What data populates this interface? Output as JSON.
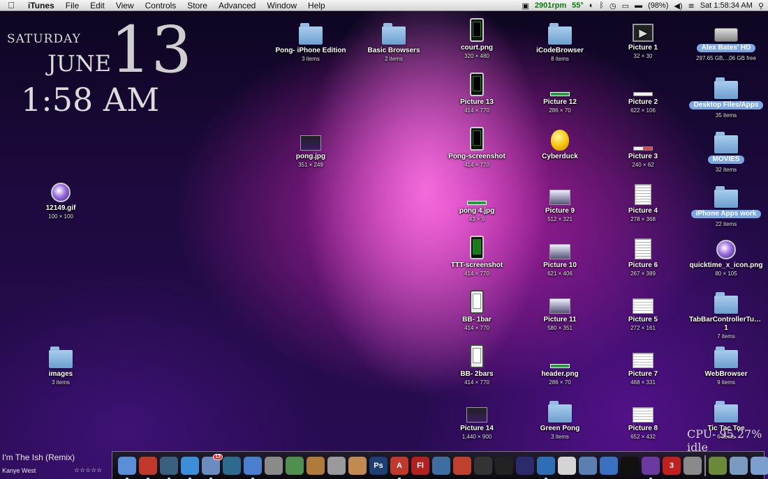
{
  "menubar": {
    "apple_icon": "",
    "items": [
      "iTunes",
      "File",
      "Edit",
      "View",
      "Controls",
      "Store",
      "Advanced",
      "Window",
      "Help"
    ],
    "extras": {
      "fan": "2901rpm",
      "temp": "55°",
      "battery": "(98%)",
      "clock": "Sat 1:58:34 AM"
    }
  },
  "clock_widget": {
    "day": "SATURDAY",
    "month": "JUNE",
    "date": "13",
    "time": "1:58 AM"
  },
  "desktop_icons": [
    {
      "label": "Pong- iPhone Edition",
      "sub": "3 items"
    },
    {
      "label": "Basic Browsers",
      "sub": "2 items"
    },
    {
      "label": "court.png",
      "sub": "320 × 480"
    },
    {
      "label": "iCodeBrowser",
      "sub": "8 items"
    },
    {
      "label": "Picture 1",
      "sub": "32 × 30"
    },
    {
      "label": "Alex Bates' HD",
      "sub": "297.65 GB,...06 GB free"
    },
    {
      "label": "Picture 13",
      "sub": "414 × 770"
    },
    {
      "label": "Picture 12",
      "sub": "286 × 70"
    },
    {
      "label": "Picture 2",
      "sub": "622 × 106"
    },
    {
      "label": "Desktop Files/Apps",
      "sub": "35 items"
    },
    {
      "label": "pong.jpg",
      "sub": "351 × 249"
    },
    {
      "label": "Pong-screenshot",
      "sub": "414 × 770"
    },
    {
      "label": "Cyberduck",
      "sub": ""
    },
    {
      "label": "Picture 3",
      "sub": "240 × 62"
    },
    {
      "label": "MOVIES",
      "sub": "32 items"
    },
    {
      "label": "12149.gif",
      "sub": "100 × 100"
    },
    {
      "label": "pong 4.jpg",
      "sub": "43 × 9"
    },
    {
      "label": "Picture 9",
      "sub": "512 × 321"
    },
    {
      "label": "Picture 4",
      "sub": "278 × 368"
    },
    {
      "label": "iPhone Apps work",
      "sub": "22 items"
    },
    {
      "label": "TTT-screenshot",
      "sub": "414 × 770"
    },
    {
      "label": "Picture 10",
      "sub": "621 × 406"
    },
    {
      "label": "Picture 6",
      "sub": "267 × 389"
    },
    {
      "label": "quicktime_x_icon.png",
      "sub": "80 × 105"
    },
    {
      "label": "BB- 1bar",
      "sub": "414 × 770"
    },
    {
      "label": "Picture 11",
      "sub": "580 × 351"
    },
    {
      "label": "Picture 5",
      "sub": "272 × 161"
    },
    {
      "label": "TabBarControllerTutorial-1",
      "sub": "7 items"
    },
    {
      "label": "images",
      "sub": "3 items"
    },
    {
      "label": "BB- 2bars",
      "sub": "414 × 770"
    },
    {
      "label": "header.png",
      "sub": "286 × 70"
    },
    {
      "label": "Picture 7",
      "sub": "468 × 331"
    },
    {
      "label": "WebBrowser",
      "sub": "9 items"
    },
    {
      "label": "Picture 14",
      "sub": "1,440 × 900"
    },
    {
      "label": "Green Pong",
      "sub": "3 items"
    },
    {
      "label": "Picture 8",
      "sub": "652 × 432"
    },
    {
      "label": "Tic Tac Toe",
      "sub": "6 items"
    }
  ],
  "now_playing": {
    "track": "I'm The Ish (Remix)",
    "artist": "Kanye West",
    "rating": "☆☆☆☆☆"
  },
  "cpu_widget": "CPU- 95.27% idle",
  "dock": {
    "items": [
      {
        "icon": "finder-icon",
        "color": "#5a8fd8"
      },
      {
        "icon": "parallels-icon",
        "color": "#c0392b"
      },
      {
        "icon": "time-machine-icon",
        "color": "#3a5f7f"
      },
      {
        "icon": "safari-icon",
        "color": "#3b8fd9"
      },
      {
        "icon": "mail-icon",
        "color": "#6a8cc0",
        "badge": "13"
      },
      {
        "icon": "dashboard-icon",
        "color": "#2d6a8f"
      },
      {
        "icon": "itunes-icon",
        "color": "#4a7fd0"
      },
      {
        "icon": "script-editor-icon",
        "color": "#8a8a8a"
      },
      {
        "icon": "preview-icon",
        "color": "#4f8f4f"
      },
      {
        "icon": "keynote-icon",
        "color": "#b07a3a"
      },
      {
        "icon": "printer-icon",
        "color": "#9a9a9a"
      },
      {
        "icon": "iphoto-icon",
        "color": "#c08a50"
      },
      {
        "icon": "photoshop-icon",
        "color": "#1d3f74",
        "text": "Ps"
      },
      {
        "icon": "acrobat-icon",
        "color": "#c0392b",
        "text": "A"
      },
      {
        "icon": "flash-icon",
        "color": "#b32020",
        "text": "Fl"
      },
      {
        "icon": "coda-icon",
        "color": "#3e6ea0"
      },
      {
        "icon": "rss-icon",
        "color": "#c04030"
      },
      {
        "icon": "itunes-visualizer-icon",
        "color": "#333"
      },
      {
        "icon": "final-cut-icon",
        "color": "#222"
      },
      {
        "icon": "dvd-icon",
        "color": "#2b2b6b"
      },
      {
        "icon": "xcode-icon",
        "color": "#2e6eb5"
      },
      {
        "icon": "textedit-icon",
        "color": "#d4d4d4"
      },
      {
        "icon": "interface-builder-icon",
        "color": "#5a7fb0"
      },
      {
        "icon": "instruments-icon",
        "color": "#3a70c0"
      },
      {
        "icon": "terminal-icon",
        "color": "#111"
      },
      {
        "icon": "quicktime-icon",
        "color": "#6b3aa0"
      },
      {
        "icon": "ical-icon",
        "color": "#c02020",
        "text": "3"
      },
      {
        "icon": "system-preferences-icon",
        "color": "#8a8a8a"
      },
      {
        "icon": "archive-utility-icon",
        "color": "#6a8a3a"
      },
      {
        "icon": "documents-stack-icon",
        "color": "#7a9ac0"
      },
      {
        "icon": "downloads-stack-icon",
        "color": "#7aa0d0"
      },
      {
        "icon": "trash-icon",
        "color": "#c8c8c8"
      }
    ]
  }
}
